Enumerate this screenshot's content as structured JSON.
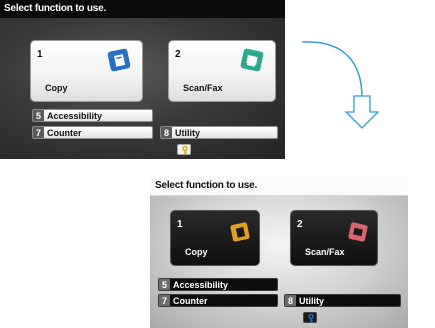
{
  "screen_top": {
    "title": "Select function to use.",
    "tiles": [
      {
        "num": "1",
        "label": "Copy"
      },
      {
        "num": "2",
        "label": "Scan/Fax"
      }
    ],
    "bars": [
      {
        "num": "5",
        "label": "Accessibility"
      },
      {
        "num": "7",
        "label": "Counter"
      },
      {
        "num": "8",
        "label": "Utility"
      }
    ]
  },
  "screen_bottom": {
    "title": "Select function to use.",
    "tiles": [
      {
        "num": "1",
        "label": "Copy"
      },
      {
        "num": "2",
        "label": "Scan/Fax"
      }
    ],
    "bars": [
      {
        "num": "5",
        "label": "Accessibility"
      },
      {
        "num": "7",
        "label": "Counter"
      },
      {
        "num": "8",
        "label": "Utility"
      }
    ]
  },
  "colors": {
    "arrow": "#2f9fd8",
    "copy_icon_top": "#2a6fc0",
    "scan_icon_top": "#2ea78f",
    "copy_icon_bottom": "#e0a024",
    "scan_icon_bottom": "#d8646e",
    "key_icon_top": "#d8a400",
    "key_icon_bottom": "#2a6fd8"
  },
  "icons": [
    "copy-icon",
    "scan-fax-icon",
    "key-icon",
    "curved-arrow-icon"
  ]
}
